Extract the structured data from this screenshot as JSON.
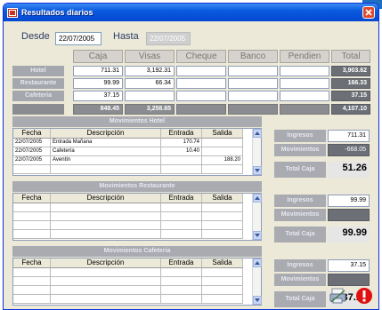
{
  "window": {
    "title": "Resultados diarios"
  },
  "dates": {
    "desde_label": "Desde",
    "desde_value": "22/07/2005",
    "hasta_label": "Hasta",
    "hasta_value": "22/07/2005"
  },
  "columns": [
    "Caja",
    "Visas",
    "Cheque",
    "Banco",
    "Pendien",
    "Total"
  ],
  "rows": [
    {
      "label": "Hotel",
      "values": [
        "711.31",
        "3,192.31",
        "",
        "",
        "",
        "3,903.62"
      ]
    },
    {
      "label": "Restaurante",
      "values": [
        "99.99",
        "66.34",
        "",
        "",
        "",
        "166.33"
      ]
    },
    {
      "label": "Cafeteria",
      "values": [
        "37.15",
        "",
        "",
        "",
        "",
        "37.15"
      ]
    }
  ],
  "totals": [
    "848.45",
    "3,258.65",
    "",
    "",
    "",
    "4,107.10"
  ],
  "grid_headers": [
    "Fecha",
    "Descripción",
    "Entrada",
    "Salida"
  ],
  "sections": [
    {
      "title": "Movimientos Hotel",
      "rows": [
        [
          "22/07/2005",
          "Entrada Mañana",
          "170.74",
          ""
        ],
        [
          "22/07/2005",
          "Cafetería",
          "10.40",
          ""
        ],
        [
          "22/07/2005",
          "Aventín",
          "",
          "188.20"
        ]
      ],
      "summary": {
        "ingresos_label": "Ingresos",
        "ingresos": "711.31",
        "movimientos_label": "Movimientos",
        "movimientos": "-668.05",
        "total_label": "Total Caja",
        "total": "51.26"
      }
    },
    {
      "title": "Movimientos Restaurante",
      "rows": [],
      "summary": {
        "ingresos_label": "Ingresos",
        "ingresos": "99.99",
        "movimientos_label": "Movimientos",
        "movimientos": "",
        "total_label": "Total Caja",
        "total": "99.99"
      }
    },
    {
      "title": "Movimientos Cafeteria",
      "rows": [],
      "summary": {
        "ingresos_label": "Ingresos",
        "ingresos": "37.15",
        "movimientos_label": "Movimientos",
        "movimientos": "",
        "total_label": "Total Caja",
        "total": "37.15"
      }
    }
  ],
  "icons": {
    "app": "app-icon",
    "close": "close-icon",
    "print": "print-icon",
    "alert": "alert-icon"
  },
  "colors": {
    "title_bar": "#0a5ae0",
    "alert": "#e01010",
    "dark_cell": "#6d6f76"
  }
}
